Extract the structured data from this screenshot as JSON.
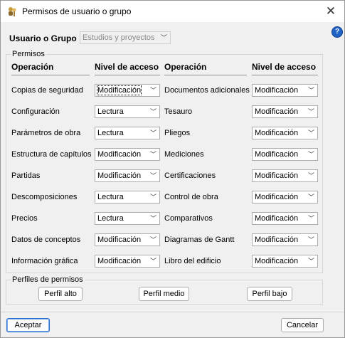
{
  "window": {
    "title": "Permisos de usuario o grupo"
  },
  "user": {
    "label": "Usuario o Grupo",
    "value": "Estudios y proyectos"
  },
  "permissions": {
    "legend": "Permisos",
    "header_op": "Operación",
    "header_level": "Nivel de acceso",
    "left": [
      {
        "op": "Copias de seguridad",
        "level": "Modificación"
      },
      {
        "op": "Configuración",
        "level": "Lectura"
      },
      {
        "op": "Parámetros de obra",
        "level": "Lectura"
      },
      {
        "op": "Estructura de capítulos",
        "level": "Modificación"
      },
      {
        "op": "Partidas",
        "level": "Modificación"
      },
      {
        "op": "Descomposiciones",
        "level": "Lectura"
      },
      {
        "op": "Precios",
        "level": "Lectura"
      },
      {
        "op": "Datos de conceptos",
        "level": "Modificación"
      },
      {
        "op": "Información gráfica",
        "level": "Modificación"
      }
    ],
    "right": [
      {
        "op": "Documentos adicionales",
        "level": "Modificación"
      },
      {
        "op": "Tesauro",
        "level": "Modificación"
      },
      {
        "op": "Pliegos",
        "level": "Modificación"
      },
      {
        "op": "Mediciones",
        "level": "Modificación"
      },
      {
        "op": "Certificaciones",
        "level": "Modificación"
      },
      {
        "op": "Control de obra",
        "level": "Modificación"
      },
      {
        "op": "Comparativos",
        "level": "Modificación"
      },
      {
        "op": "Diagramas de Gantt",
        "level": "Modificación"
      },
      {
        "op": "Libro del edificio",
        "level": "Modificación"
      }
    ]
  },
  "profiles": {
    "legend": "Perfiles de permisos",
    "high": "Perfil alto",
    "medium": "Perfil medio",
    "low": "Perfil bajo"
  },
  "footer": {
    "accept": "Aceptar",
    "cancel": "Cancelar"
  },
  "icons": {
    "app": "users-key-icon",
    "close": "close-icon",
    "help": "help-icon",
    "dropdown": "chevron-down-icon"
  }
}
